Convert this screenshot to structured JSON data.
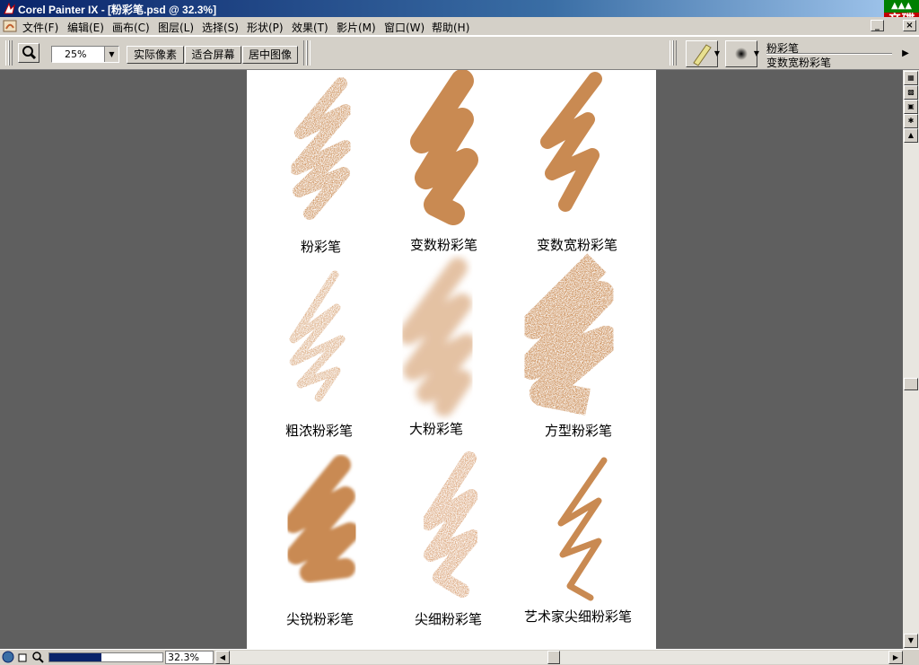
{
  "window": {
    "title": "Corel Painter IX - [粉彩笔.psd @ 32.3%]"
  },
  "menu": [
    "文件(F)",
    "编辑(E)",
    "画布(C)",
    "图层(L)",
    "选择(S)",
    "形状(P)",
    "效果(T)",
    "影片(M)",
    "窗口(W)",
    "帮助(H)"
  ],
  "toolbar": {
    "zoom_value": "25%",
    "actual_pixels": "实际像素",
    "fit_screen": "适合屏幕",
    "center_image": "居中图像",
    "brush_category": "粉彩笔",
    "brush_variant": "变数宽粉彩笔"
  },
  "canvas": {
    "labels": [
      "粉彩笔",
      "变数粉彩笔",
      "变数宽粉彩笔",
      "粗浓粉彩笔",
      "大粉彩笔",
      "方型粉彩笔",
      "尖锐粉彩笔",
      "尖细粉彩笔",
      "艺术家尖细粉彩笔"
    ],
    "stroke_color": "#c98a52"
  },
  "status": {
    "zoom": "32.3%"
  },
  "watermark": {
    "line1": "音",
    "line2": "碟",
    "line3": "软",
    "line4": "件"
  }
}
